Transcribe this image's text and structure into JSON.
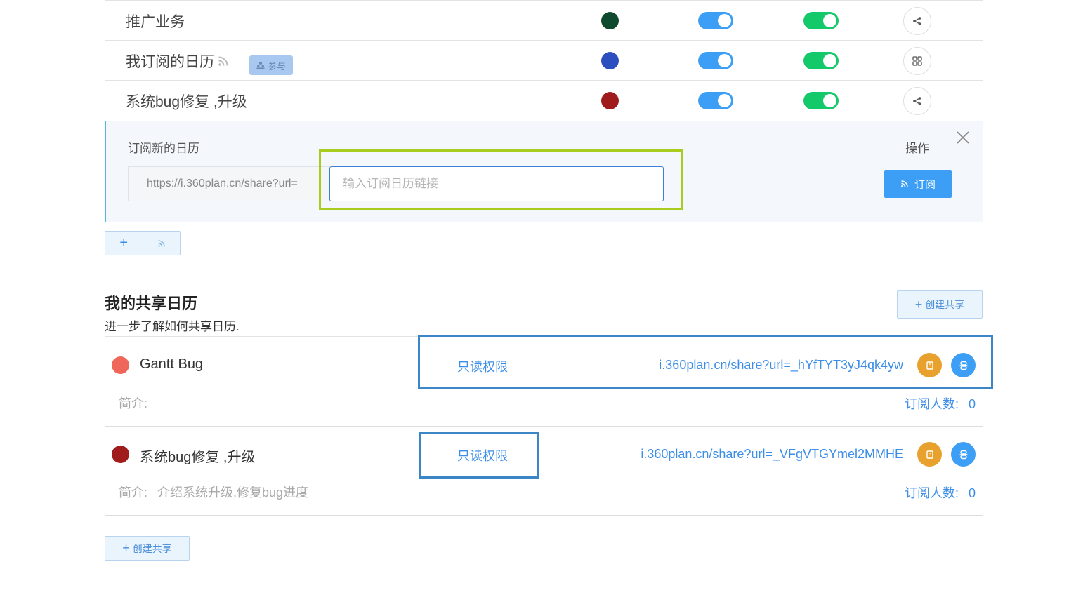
{
  "calendars": [
    {
      "name": "推广业务",
      "color": "#0e4a2e",
      "action_icon": "share-icon",
      "rss": false,
      "badge": null
    },
    {
      "name": "我订阅的日历",
      "color": "#2c4fbf",
      "action_icon": "grid-icon",
      "rss": true,
      "badge": "参与"
    },
    {
      "name": "系统bug修复 ,升级",
      "color": "#a01b1b",
      "action_icon": "share-icon",
      "rss": false,
      "badge": null
    }
  ],
  "subscribe_panel": {
    "title": "订阅新的日历",
    "operation_label": "操作",
    "url_prefix": "https://i.360plan.cn/share?url=",
    "input_placeholder": "输入订阅日历链接",
    "subscribe_button": "订阅"
  },
  "add_buttons": {
    "plus": "+"
  },
  "shared_section": {
    "title": "我的共享日历",
    "subtitle": "进一步了解如何共享日历.",
    "create_share_label": "创建共享",
    "items": [
      {
        "name": "Gantt Bug",
        "color": "#ef675a",
        "permission": "只读权限",
        "link": "i.360plan.cn/share?url=_hYfTYT3yJ4qk4yw",
        "desc_label": "简介:",
        "desc": "",
        "subs_label": "订阅人数:",
        "subs_count": "0"
      },
      {
        "name": "系统bug修复 ,升级",
        "color": "#a01b1b",
        "permission": "只读权限",
        "link": "i.360plan.cn/share?url=_VFgVTGYmel2MMHE",
        "desc_label": "简介:",
        "desc": "介绍系统升级,修复bug进度",
        "subs_label": "订阅人数:",
        "subs_count": "0"
      }
    ]
  },
  "colors": {
    "accent_blue": "#3c9ef5",
    "toggle_green": "#13c96a",
    "copy_orange": "#e9a12d",
    "highlight_green": "#a7cc1e",
    "highlight_blue": "#3b86c6"
  }
}
